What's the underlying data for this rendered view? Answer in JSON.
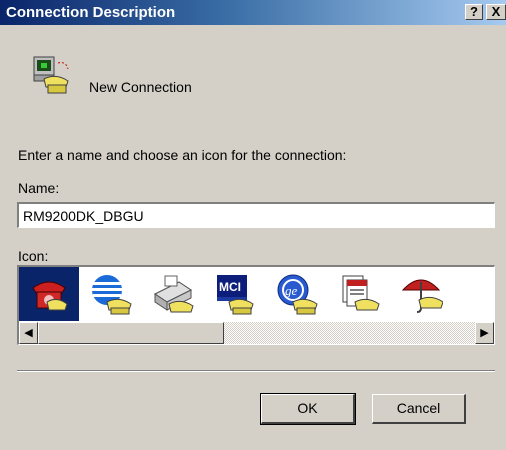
{
  "window": {
    "title": "Connection Description",
    "help_glyph": "?",
    "close_glyph": "X"
  },
  "header": {
    "label": "New Connection",
    "icon": "phone-computer-icon"
  },
  "form": {
    "instruction": "Enter a name and choose an icon for the connection:",
    "name_label": "Name:",
    "name_value": "RM9200DK_DBGU",
    "icon_label": "Icon:"
  },
  "icons": [
    {
      "name": "red-phone-icon",
      "selected": true
    },
    {
      "name": "globe-phone-icon",
      "selected": false
    },
    {
      "name": "fax-phone-icon",
      "selected": false
    },
    {
      "name": "mci-phone-icon",
      "selected": false
    },
    {
      "name": "ge-phone-icon",
      "selected": false
    },
    {
      "name": "documents-phone-icon",
      "selected": false
    },
    {
      "name": "umbrella-phone-icon",
      "selected": false
    }
  ],
  "scrollbar": {
    "left_arrow": "◀",
    "right_arrow": "▶"
  },
  "buttons": {
    "ok": "OK",
    "cancel": "Cancel"
  },
  "colors": {
    "title_bar": "#0a246a",
    "dialog_bg": "#d4d0c8",
    "selection": "#0a246a"
  }
}
